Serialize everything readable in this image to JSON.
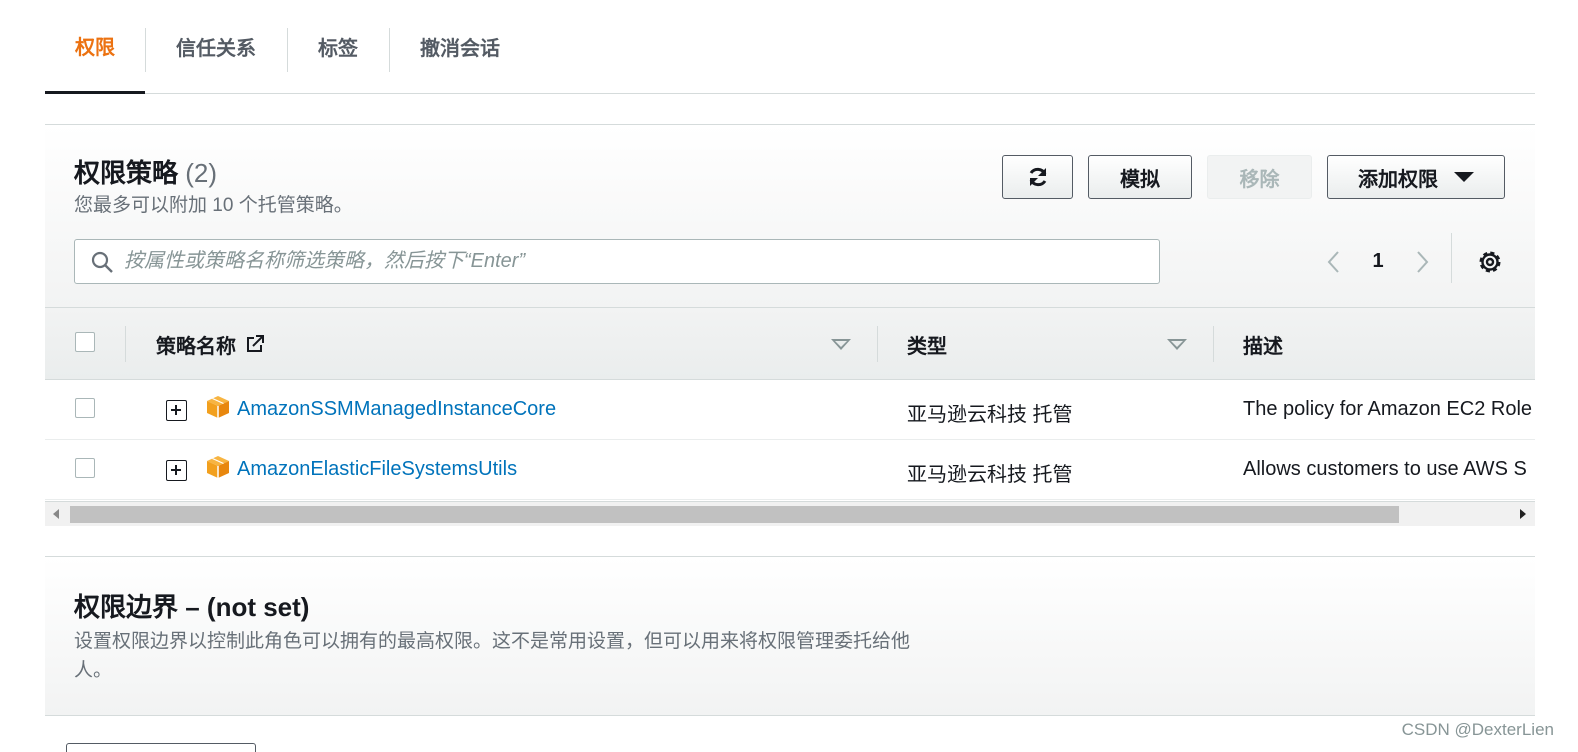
{
  "tabs": [
    {
      "label": "权限",
      "active": true
    },
    {
      "label": "信任关系",
      "active": false
    },
    {
      "label": "标签",
      "active": false
    },
    {
      "label": "撤消会话",
      "active": false
    }
  ],
  "policies": {
    "title": "权限策略",
    "count": "(2)",
    "subtitle": "您最多可以附加 10 个托管策略。",
    "buttons": {
      "refresh_icon": "refresh-icon",
      "simulate": "模拟",
      "remove": "移除",
      "add": "添加权限"
    },
    "search_placeholder": "按属性或策略名称筛选策略，然后按下“Enter”",
    "pagination": {
      "page": "1"
    },
    "columns": {
      "name": "策略名称",
      "type": "类型",
      "description": "描述"
    },
    "rows": [
      {
        "name": "AmazonSSMManagedInstanceCore",
        "type": "亚马逊云科技 托管",
        "description": "The policy for Amazon EC2 Role"
      },
      {
        "name": "AmazonElasticFileSystemsUtils",
        "type": "亚马逊云科技 托管",
        "description": "Allows customers to use AWS S"
      }
    ]
  },
  "boundary": {
    "title": "权限边界 – (not set)",
    "description": "设置权限边界以控制此角色可以拥有的最高权限。这不是常用设置，但可以用来将权限管理委托给他人。"
  },
  "watermark": "CSDN @DexterLien",
  "colors": {
    "accent": "#ec7211",
    "link": "#0073bb",
    "text": "#16191f",
    "muted": "#687078",
    "policy_icon": "#f2a01e"
  }
}
